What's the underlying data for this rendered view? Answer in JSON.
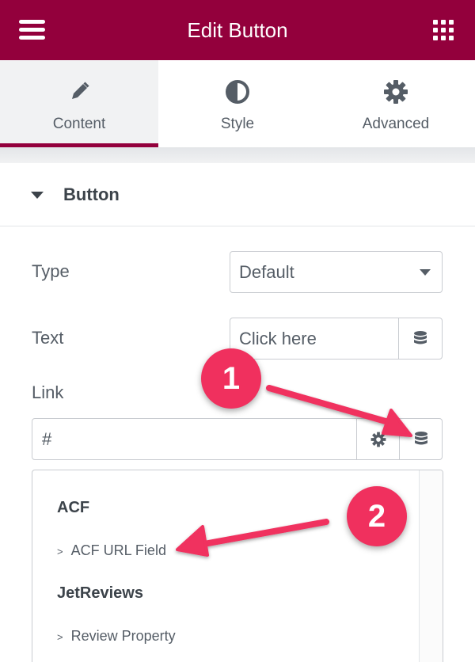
{
  "header": {
    "title": "Edit Button",
    "menu_icon": "hamburger-menu-icon",
    "apps_icon": "grid-apps-icon",
    "color": "#93003c"
  },
  "tabs": [
    {
      "label": "Content",
      "icon": "pencil-icon",
      "active": true
    },
    {
      "label": "Style",
      "icon": "half-circle-icon",
      "active": false
    },
    {
      "label": "Advanced",
      "icon": "gear-icon",
      "active": false
    }
  ],
  "section": {
    "title": "Button",
    "icon": "caret-down-icon"
  },
  "fields": {
    "type_label": "Type",
    "type_value": "Default",
    "text_label": "Text",
    "text_value": "Click here",
    "link_label": "Link",
    "link_value": "#"
  },
  "dropdown": {
    "groups": [
      {
        "title": "ACF",
        "options": [
          "ACF URL Field"
        ]
      },
      {
        "title": "JetReviews",
        "options": [
          "Review Property"
        ]
      }
    ],
    "chevron": ">"
  },
  "annotations": {
    "badge_1": "1",
    "badge_2": "2",
    "color": "#f0305e"
  }
}
